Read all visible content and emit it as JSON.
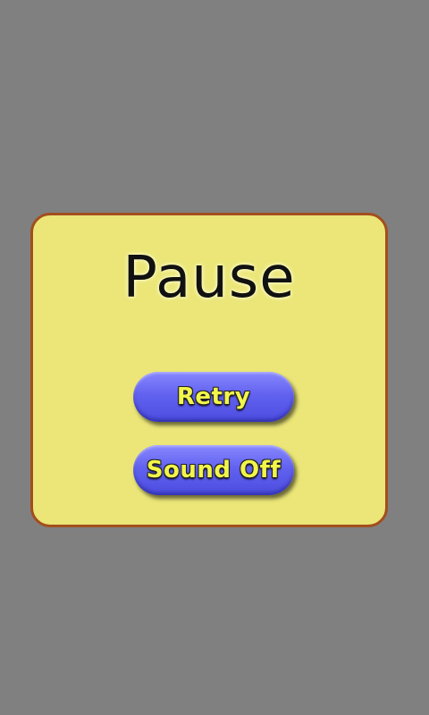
{
  "dialog": {
    "title": "Pause",
    "buttons": {
      "retry_label": "Retry",
      "sound_label": "Sound Off"
    }
  },
  "colors": {
    "background": "#808080",
    "panel": "#ebe677",
    "panel_border": "#a24e1e",
    "button": "#6262f0",
    "button_text": "#f2f54a"
  }
}
